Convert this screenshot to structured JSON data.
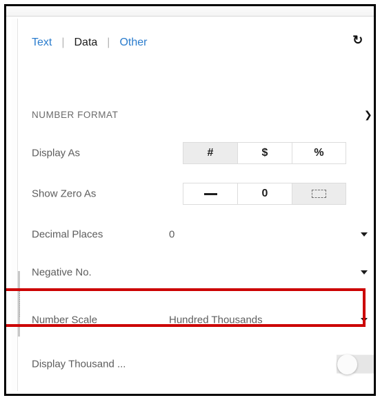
{
  "window": {
    "title": "Number Format settings panel"
  },
  "header": {
    "tabs": [
      {
        "label": "Text",
        "active": false
      },
      {
        "label": "Data",
        "active": true
      },
      {
        "label": "Other",
        "active": false
      }
    ],
    "separator": "|",
    "reset_icon": "reset-icon",
    "reset_glyph": "↻",
    "expand_icon": "chevron-right-icon",
    "expand_glyph": "›"
  },
  "section": {
    "title": "NUMBER FORMAT",
    "collapse_icon": "chevron-down-icon",
    "collapse_glyph": "❯"
  },
  "rows": {
    "display_as": {
      "label": "Display As",
      "options": [
        {
          "label": "#",
          "name": "number-format-button",
          "selected": true
        },
        {
          "label": "$",
          "name": "currency-format-button",
          "selected": false
        },
        {
          "label": "%",
          "name": "percent-format-button",
          "selected": false
        }
      ]
    },
    "show_zero_as": {
      "label": "Show Zero As",
      "options": [
        {
          "label": "—",
          "name": "dash-zero-button",
          "selected": false
        },
        {
          "label": "0",
          "name": "zero-digit-button",
          "selected": false
        },
        {
          "label": "",
          "name": "blank-zero-button",
          "selected": true
        }
      ]
    },
    "decimal_places": {
      "label": "Decimal Places",
      "value": "0"
    },
    "negative_no": {
      "label": "Negative No.",
      "value": ""
    },
    "number_scale": {
      "label": "Number Scale",
      "value": "Hundred Thousands",
      "highlighted": true
    },
    "display_thousand": {
      "label": "Display Thousand ...",
      "toggle_on": false
    }
  },
  "colors": {
    "link_blue": "#2a7ccd",
    "label_grey": "#5d5d5d",
    "section_grey": "#6b6b6b",
    "selected_bg": "#ececec",
    "border_grey": "#dcdcdc",
    "highlight_red": "#cc0000",
    "toggle_track": "#e6e6e6"
  }
}
